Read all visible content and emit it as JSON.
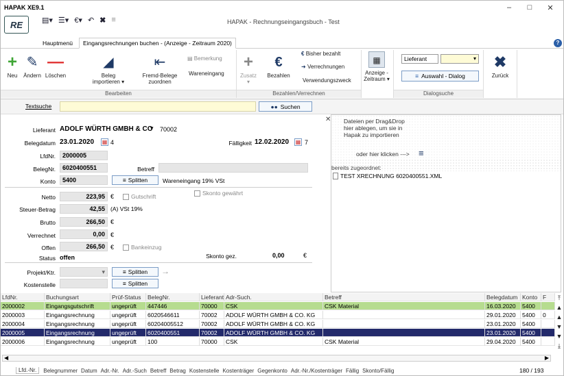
{
  "window": {
    "title": "HAPAK XE9.1",
    "app_title": "HAPAK - Rechnungseingangsbuch - Test",
    "logo": "RE"
  },
  "tabs": [
    {
      "label": "Hauptmenü"
    },
    {
      "label": "Eingangsrechnungen buchen - (Anzeige - Zeitraum 2020)"
    }
  ],
  "ribbon": {
    "buttons": {
      "neu": "Neu",
      "aendern": "Ändern",
      "loeschen": "Löschen",
      "beleg_importieren_1": "Beleg",
      "beleg_importieren_2": "importieren ▾",
      "fremd_1": "Fremd-Belege",
      "fremd_2": "zuordnen",
      "bemerkung": "Bemerkung",
      "wareneingang": "Wareneingang",
      "zusatz": "Zusatz",
      "bezahlen": "Bezahlen",
      "bisher_bezahlt": "Bisher bezahlt",
      "verrechnungen": "Verrechnungen",
      "verwendungszweck": "Verwendungszweck",
      "anzeige_1": "Anzeige -",
      "anzeige_2": "Zeitraum ▾",
      "lieferant": "Lieferant",
      "auswahl_dialog": "Auswahl - Dialog",
      "zurueck": "Zurück"
    },
    "groups": {
      "bearbeiten": "Bearbeiten",
      "bezahlen_verrechnen": "Bezahlen/Verrechnen",
      "dialogsuche": "Dialogsuche"
    }
  },
  "search": {
    "label": "Textsuche",
    "button": "Suchen",
    "value": ""
  },
  "form": {
    "lieferant_label": "Lieferant",
    "lieferant_value": "ADOLF WÜRTH GMBH & CO",
    "lieferant_nr": "70002",
    "belegdatum_label": "Belegdatum",
    "belegdatum_value": "23.01.2020",
    "belegdatum_extra": "4",
    "faelligkeit_label": "Fälligkeit",
    "faelligkeit_value": "12.02.2020",
    "faelligkeit_extra": "7",
    "lfdnr_label": "LfdNr.",
    "lfdnr_value": "2000005",
    "belegnr_label": "BelegNr.",
    "belegnr_value": "6020400551",
    "betreff_label": "Betreff",
    "betreff_value": "",
    "konto_label": "Konto",
    "konto_value": "5400",
    "splitten": "Splitten",
    "konto_text": "Wareneingang 19% VSt",
    "netto_label": "Netto",
    "netto_value": "223,95",
    "currency": "€",
    "gutschrift": "Gutschrift",
    "skonto_gewaehrt": "Skonto gewährt",
    "steuer_label": "Steuer-Betrag",
    "steuer_value": "42,55",
    "steuer_text": "(A) VSt 19%",
    "brutto_label": "Brutto",
    "brutto_value": "266,50",
    "verrechnet_label": "Verrechnet",
    "verrechnet_value": "0,00",
    "offen_label": "Offen",
    "offen_value": "266,50",
    "bankeinzug": "Bankeinzug",
    "status_label": "Status",
    "status_value": "offen",
    "skonto_gez_label": "Skonto gez.",
    "skonto_gez_value": "0,00",
    "projekt_label": "Projekt/Ktr.",
    "kostenstelle_label": "Kostenstelle"
  },
  "dropzone": {
    "text1": "Dateien per Drag&Drop",
    "text2": "hier ablegen, um sie in",
    "text3": "Hapak zu importieren",
    "click": "oder hier klicken --->",
    "assigned_label": "bereits zugeordnet:",
    "file": "TEST XRECHNUNG 6020400551.XML"
  },
  "grid": {
    "headers": [
      "LfdNr.",
      "Buchungsart",
      "Prüf-Status",
      "BelegNr.",
      "Lieferant",
      "Adr-Such.",
      "Betreff",
      "Belegdatum",
      "Konto",
      "F"
    ],
    "rows": [
      {
        "lfdnr": "2000002",
        "art": "Eingangsgutschrift",
        "status": "ungeprüft",
        "belegnr": "447446",
        "lieferant": "70000",
        "adr": "CSK",
        "betreff": "CSK Material",
        "datum": "16.03.2020",
        "konto": "5400",
        "f": ""
      },
      {
        "lfdnr": "2000003",
        "art": "Eingangsrechnung",
        "status": "ungeprüft",
        "belegnr": "6020546611",
        "lieferant": "70002",
        "adr": "ADOLF WÜRTH GMBH & CO. KG",
        "betreff": "",
        "datum": "29.01.2020",
        "konto": "5400",
        "f": "0"
      },
      {
        "lfdnr": "2000004",
        "art": "Eingangsrechnung",
        "status": "ungeprüft",
        "belegnr": "60204005512",
        "lieferant": "70002",
        "adr": "ADOLF WÜRTH GMBH & CO. KG",
        "betreff": "",
        "datum": "23.01.2020",
        "konto": "5400",
        "f": ""
      },
      {
        "lfdnr": "2000005",
        "art": "Eingangsrechnung",
        "status": "ungeprüft",
        "belegnr": "6020400551",
        "lieferant": "70002",
        "adr": "ADOLF WÜRTH GMBH & CO. KG",
        "betreff": "",
        "datum": "23.01.2020",
        "konto": "5400",
        "f": ""
      },
      {
        "lfdnr": "2000006",
        "art": "Eingangsrechnung",
        "status": "ungeprüft",
        "belegnr": "100",
        "lieferant": "70000",
        "adr": "CSK",
        "betreff": "CSK Material",
        "datum": "29.04.2020",
        "konto": "5400",
        "f": ""
      }
    ]
  },
  "bottom_tabs": [
    "Lfd.-Nr.",
    "Belegnummer",
    "Datum",
    "Adr.-Nr.",
    "Adr.-Such",
    "Betreff",
    "Betrag",
    "Kostenstelle",
    "Kostenträger",
    "Gegenkonto",
    "Adr.-Nr./Kostenträger",
    "Fällig",
    "Skonto/Fällig"
  ],
  "record_count": "180 / 193",
  "colors": {
    "selected_row": "#232a6b",
    "green_row": "#b6dc8f",
    "search_yellow": "#fefbd6",
    "neu_green": "#3fa535",
    "delete_red": "#e03030",
    "back_navy": "#1f3a66"
  }
}
